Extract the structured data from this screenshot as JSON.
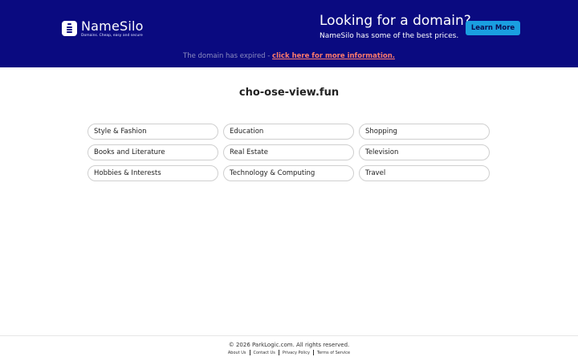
{
  "header": {
    "logo_name": "NameSilo",
    "logo_tagline": "Domains. Cheap, easy and secure",
    "promo_title": "Looking for a domain?",
    "promo_subtitle": "NameSilo has some of the best prices.",
    "learn_more_label": "Learn More",
    "expired_text": "The domain has expired - ",
    "expired_link": "click here for more information."
  },
  "main": {
    "domain": "cho-ose-view.fun",
    "categories": [
      "Style & Fashion",
      "Education",
      "Shopping",
      "Books and Literature",
      "Real Estate",
      "Television",
      "Hobbies & Interests",
      "Technology & Computing",
      "Travel"
    ]
  },
  "footer": {
    "copyright": "© 2026 ParkLogic.com. All rights reserved.",
    "links": [
      "About Us",
      "Contact Us",
      "Privacy Policy",
      "Terms of Service"
    ]
  },
  "colors": {
    "header_bg": "#0a0a80",
    "button_bg": "#1a9ee0",
    "expired_link": "#ff7b6b"
  }
}
